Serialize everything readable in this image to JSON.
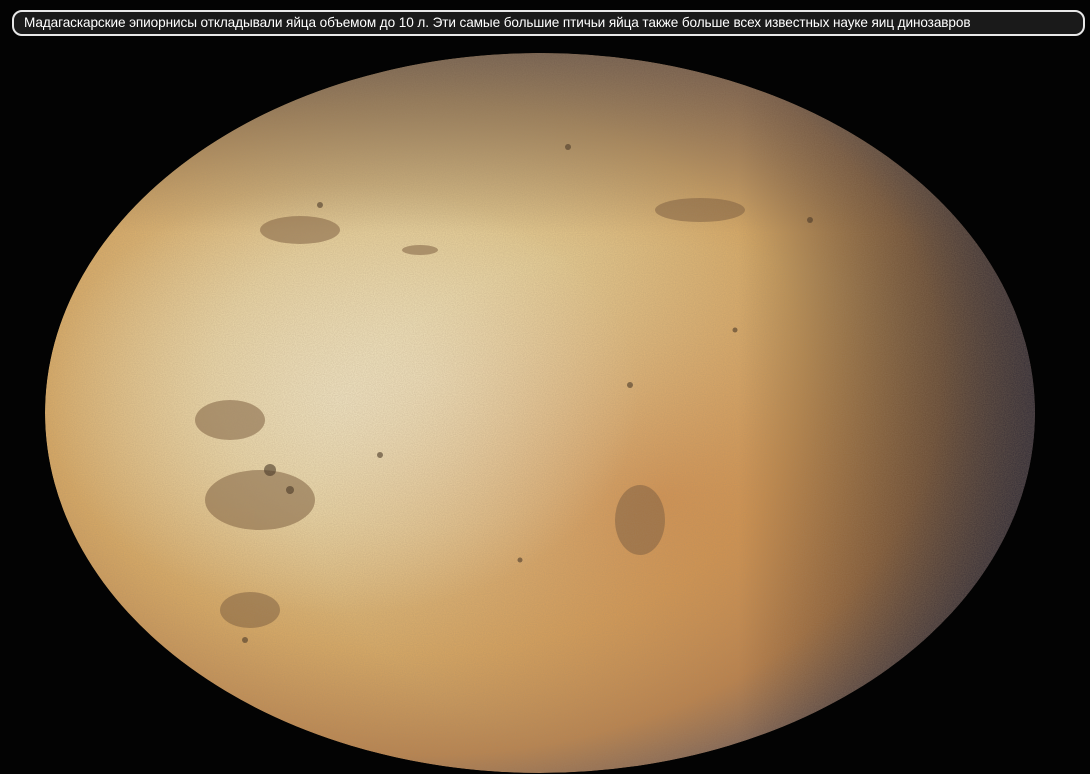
{
  "caption": {
    "text": "Мадагаскарские эпиорнисы откладывали яйца объемом до 10 л. Эти самые большие птичьи яйца также больше всех известных науке яиц динозавров"
  },
  "photo": {
    "subject": "aepyornis-egg",
    "colors": {
      "background": "#000000",
      "shell_light": "#ead9a8",
      "shell_mid": "#d4a45c",
      "shell_warm": "#c07a3a",
      "shell_shadow": "#3a3a4a",
      "caption_bg": "#1a1a1a",
      "caption_border": "#e8e8e8",
      "caption_text": "#ffffff"
    }
  }
}
